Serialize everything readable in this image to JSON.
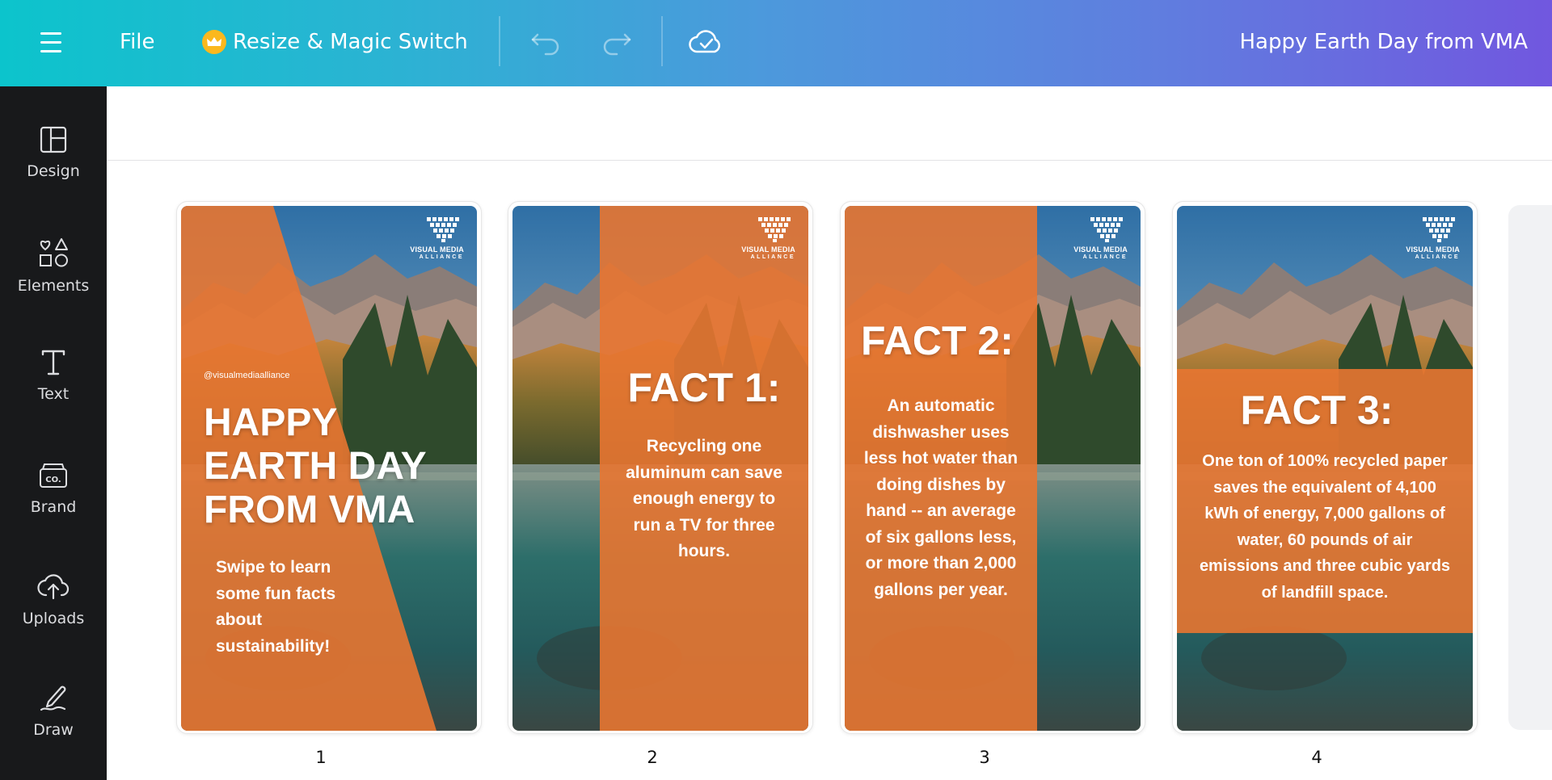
{
  "topbar": {
    "file_label": "File",
    "resize_label": "Resize & Magic Switch",
    "doc_title": "Happy Earth Day from VMA",
    "icons": [
      "menu-icon",
      "crown-icon",
      "undo-icon",
      "redo-icon",
      "cloud-check-icon"
    ]
  },
  "sidebar": {
    "items": [
      {
        "label": "Design",
        "icon": "layout-icon"
      },
      {
        "label": "Elements",
        "icon": "shapes-icon"
      },
      {
        "label": "Text",
        "icon": "text-icon"
      },
      {
        "label": "Brand",
        "icon": "brand-icon"
      },
      {
        "label": "Uploads",
        "icon": "cloud-upload-icon"
      },
      {
        "label": "Draw",
        "icon": "draw-icon"
      }
    ]
  },
  "pages": [
    {
      "number": "1",
      "logo_line1": "VISUAL MEDIA",
      "logo_line2": "ALLIANCE",
      "handle": "@visualmediaalliance",
      "headline_lines": [
        "HAPPY",
        "EARTH DAY",
        "FROM VMA"
      ],
      "body_lines": [
        "Swipe to learn",
        "some fun facts",
        "about",
        "sustainability!"
      ]
    },
    {
      "number": "2",
      "logo_line1": "VISUAL MEDIA",
      "logo_line2": "ALLIANCE",
      "heading": "FACT 1:",
      "body_lines": [
        "Recycling one",
        "aluminum can save",
        "enough energy to",
        "run a TV for three",
        "hours."
      ]
    },
    {
      "number": "3",
      "logo_line1": "VISUAL MEDIA",
      "logo_line2": "ALLIANCE",
      "heading": "FACT 2:",
      "body_lines": [
        "An automatic",
        "dishwasher uses",
        "less hot water than",
        "doing dishes by",
        "hand -- an average",
        "of six gallons less,",
        "or more than 2,000",
        "gallons per year."
      ]
    },
    {
      "number": "4",
      "logo_line1": "VISUAL MEDIA",
      "logo_line2": "ALLIANCE",
      "heading": "FACT 3:",
      "body_lines": [
        "One ton of 100% recycled paper",
        "saves the equivalent of 4,100",
        "kWh of energy, 7,000 gallons of",
        "water, 60 pounds of air",
        "emissions and three cubic yards",
        "of landfill space."
      ]
    }
  ],
  "colors": {
    "orange_overlay": "#e87531",
    "sidebar_bg": "#18191b",
    "gradient_start": "#0cc4cc",
    "gradient_end": "#7157df"
  }
}
